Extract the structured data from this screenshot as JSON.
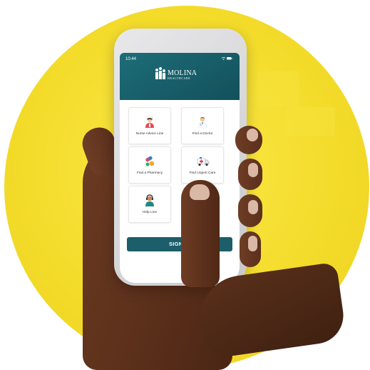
{
  "status_bar": {
    "time": "10:44",
    "icons": "wifi-battery"
  },
  "brand": {
    "name": "MOLINA",
    "tagline": "HEALTHCARE",
    "header_color": "#1a6470"
  },
  "tiles": [
    {
      "label": "Nurse Advice Line",
      "icon": "nurse-icon"
    },
    {
      "label": "Find a Doctor",
      "icon": "doctor-icon"
    },
    {
      "label": "Find a Pharmacy",
      "icon": "pharmacy-icon"
    },
    {
      "label": "Find Urgent Care",
      "icon": "ambulance-icon"
    },
    {
      "label": "Help Line",
      "icon": "headset-icon"
    }
  ],
  "sign_in": {
    "label": "SIGN IN",
    "color": "#1c5e69"
  },
  "background": {
    "accent": "#f4dc2b"
  }
}
